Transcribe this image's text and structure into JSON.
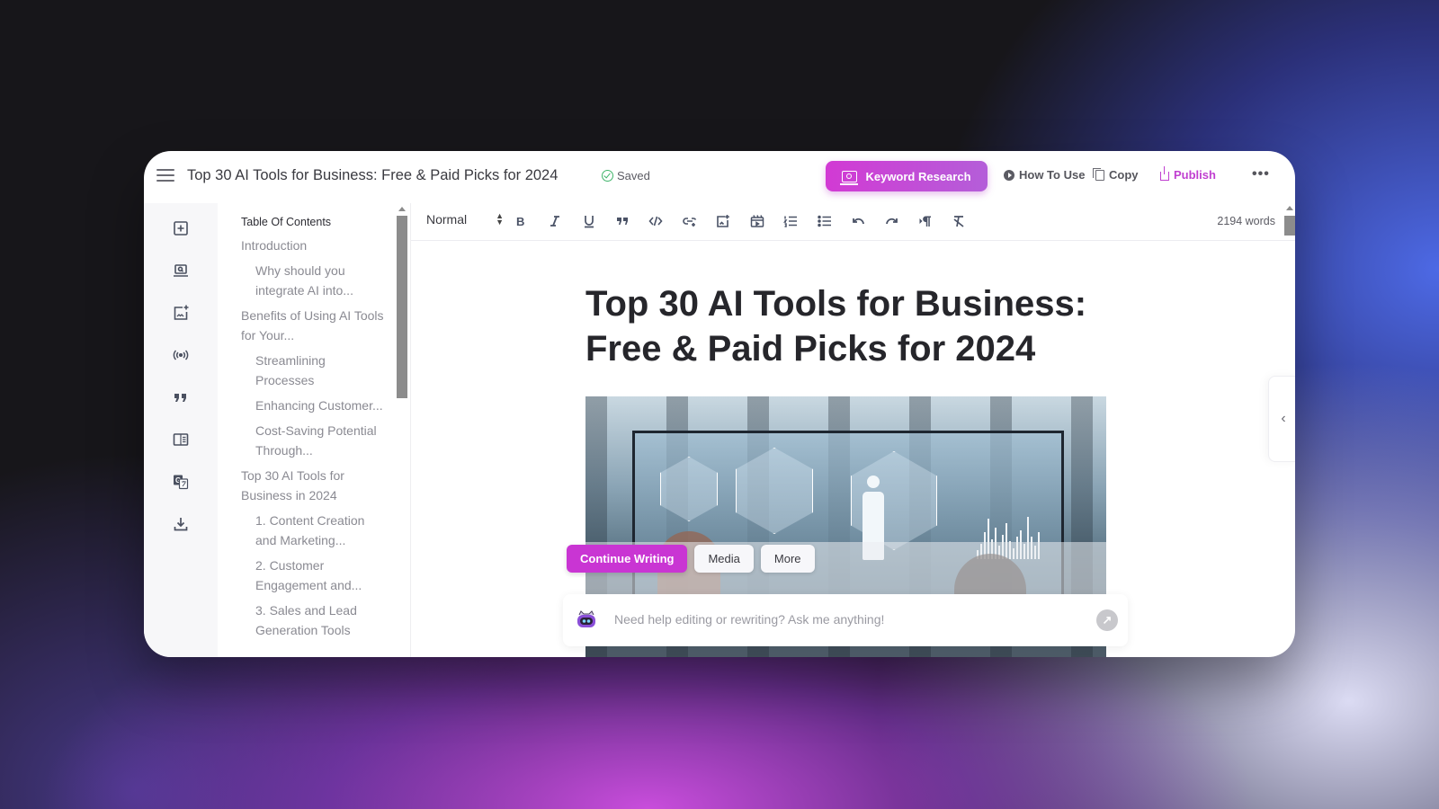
{
  "app": {
    "document_title": "Top 30 AI Tools for Business: Free & Paid Picks for 2024",
    "save_status": "Saved"
  },
  "header": {
    "keyword_research_label": "Keyword Research",
    "how_to_use_label": "How To Use",
    "copy_label": "Copy",
    "publish_label": "Publish",
    "more_label": "•••",
    "accent_color": "#c935d3"
  },
  "rail": {
    "icons": [
      "add-block-icon",
      "keyword-research-icon",
      "add-image-icon",
      "broadcast-icon",
      "quote-icon",
      "layout-icon",
      "translate-icon",
      "download-icon"
    ]
  },
  "toc": {
    "title": "Table Of Contents",
    "items": [
      {
        "label": "Introduction",
        "level": 1
      },
      {
        "label": "Why should you integrate AI into...",
        "level": 2
      },
      {
        "label": "Benefits of Using AI Tools for Your...",
        "level": 1
      },
      {
        "label": "Streamlining Processes",
        "level": 2
      },
      {
        "label": "Enhancing Customer...",
        "level": 2
      },
      {
        "label": "Cost-Saving Potential Through...",
        "level": 2
      },
      {
        "label": "Top 30 AI Tools for Business in 2024",
        "level": 1
      },
      {
        "label": "1. Content Creation and Marketing...",
        "level": 2
      },
      {
        "label": "2. Customer Engagement and...",
        "level": 2
      },
      {
        "label": "3. Sales and Lead Generation Tools",
        "level": 2
      }
    ]
  },
  "toolbar": {
    "format_value": "Normal",
    "word_count": "2194 words",
    "tools": [
      "bold",
      "italic",
      "underline",
      "blockquote",
      "code",
      "link",
      "insert-image",
      "insert-video",
      "ordered-list",
      "bullet-list",
      "undo",
      "redo",
      "text-direction",
      "clear-format"
    ]
  },
  "article": {
    "title": "Top 30 AI Tools for Business: Free & Paid Picks for 2024"
  },
  "assistant": {
    "continue_label": "Continue Writing",
    "media_label": "Media",
    "more_label": "More",
    "ask_placeholder": "Need help editing or rewriting? Ask me anything!",
    "send_icon": "↗"
  },
  "panel": {
    "collapse_icon": "‹"
  }
}
